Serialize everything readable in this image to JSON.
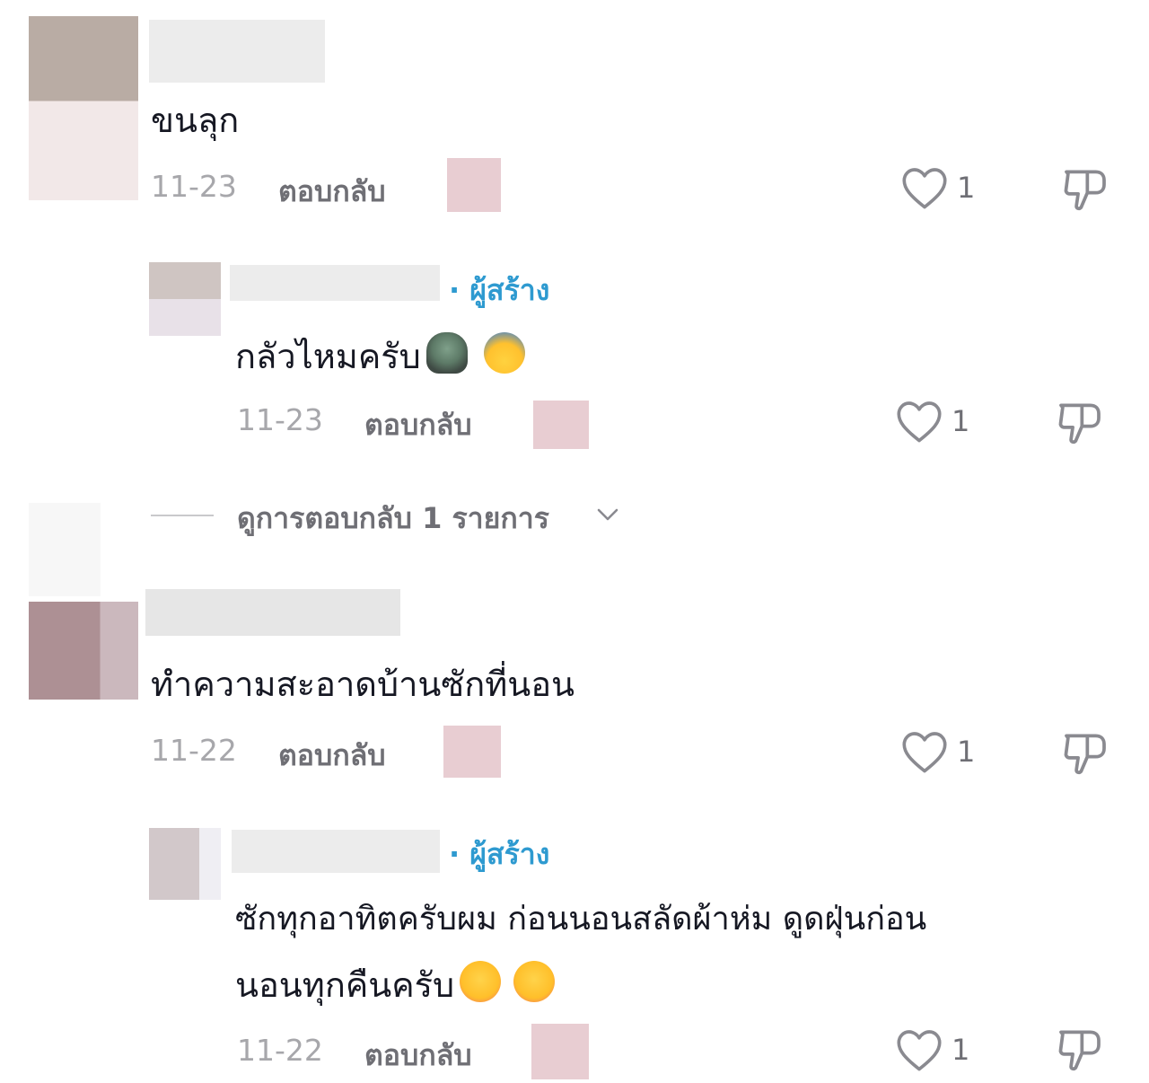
{
  "comments": [
    {
      "text": "ขนลุก",
      "date": "11-23",
      "reply_label": "ตอบกลับ",
      "likes": "1",
      "replies": [
        {
          "creator_label": "· ผู้สร้าง",
          "text": "กลัวไหมครับ",
          "emojis": [
            "zombie-woman-emoji",
            "face-screaming-in-fear-emoji"
          ],
          "date": "11-23",
          "reply_label": "ตอบกลับ",
          "likes": "1"
        }
      ],
      "view_replies": "ดูการตอบกลับ 1 รายการ"
    },
    {
      "text": "ทำความสะอาดบ้านซักที่นอน",
      "date": "11-22",
      "reply_label": "ตอบกลับ",
      "likes": "1",
      "replies": [
        {
          "creator_label": "· ผู้สร้าง",
          "text_line1": "ซักทุกอาทิตครับผม ก่อนนอนสลัดผ้าห่ม ดูดฝุ่นก่อน",
          "text_line2": "นอนทุกคืนครับ",
          "emojis": [
            "smiling-face-with-hearts-emoji",
            "smiling-face-with-hearts-emoji"
          ],
          "date": "11-22",
          "reply_label": "ตอบกลับ",
          "likes": "1"
        }
      ]
    }
  ],
  "icons": {
    "like": "heart-outline-icon",
    "dislike": "thumbs-down-icon",
    "expand": "chevron-down-icon"
  },
  "colors": {
    "creator": "#2e9ad0",
    "date": "#a7a7ab",
    "secondary_text": "#6f6f75"
  }
}
